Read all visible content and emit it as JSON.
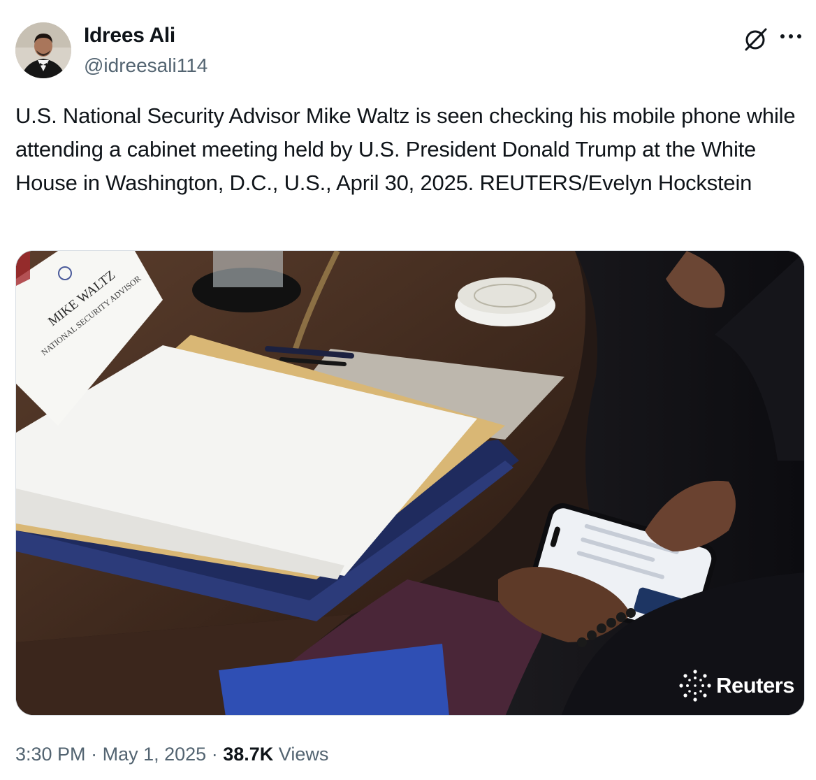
{
  "author": {
    "name": "Idrees Ali",
    "handle": "@idreesali114"
  },
  "tweet": {
    "text": "U.S. National Security Advisor Mike Waltz is seen checking his mobile phone while attending a cabinet meeting held by U.S. President Donald Trump at the White House in Washington, D.C., U.S., April 30, 2025. REUTERS/Evelyn Hockstein"
  },
  "media": {
    "name_card_line1": "MIKE WALTZ",
    "name_card_line2": "NATIONAL SECURITY ADVISOR",
    "watermark": "Reuters"
  },
  "meta": {
    "time": "3:30 PM",
    "separator": "·",
    "date": "May 1, 2025",
    "views_count": "38.7K",
    "views_label": "Views"
  },
  "icons": {
    "grok": "grok-icon",
    "more": "more-icon",
    "reuters": "reuters-logo-icon"
  },
  "colors": {
    "text": "#0f1419",
    "secondary": "#536471"
  }
}
